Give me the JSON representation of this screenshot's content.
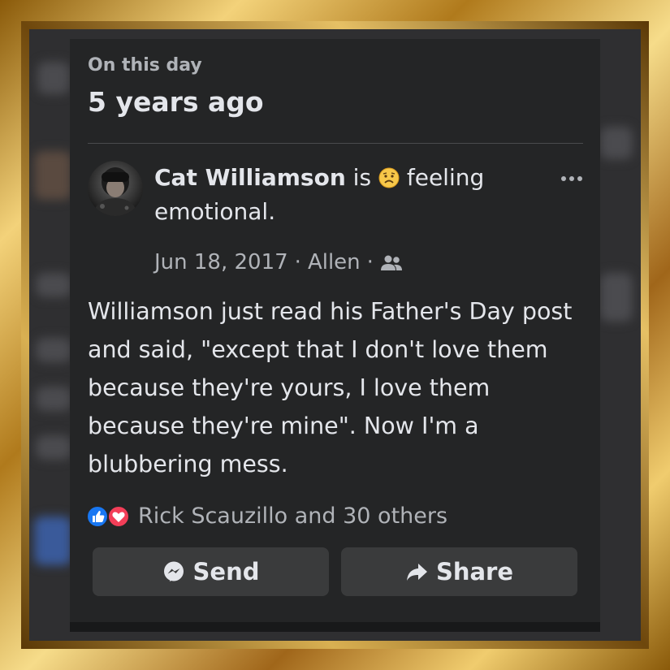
{
  "header": {
    "label": "On this day",
    "title": "5 years ago"
  },
  "post": {
    "author": "Cat Williamson",
    "is_word": "is",
    "feeling_text": "feeling",
    "feeling_value": "emotional.",
    "feeling_icon": "sad-face-icon",
    "date": "Jun 18, 2017",
    "separator": "·",
    "location": "Allen",
    "audience_icon": "friends-icon",
    "body": "Williamson just read his Father's Day post and said, \"except that I don't love them because they're yours, I love them because they're mine\". Now I'm a blubbering mess.",
    "more_icon": "more-options-icon"
  },
  "reactions": {
    "icons": [
      "like-icon",
      "love-icon"
    ],
    "text": "Rick Scauzillo and 30 others"
  },
  "actions": {
    "send_label": "Send",
    "share_label": "Share"
  },
  "colors": {
    "card_bg": "#242526",
    "primary_text": "#e4e6eb",
    "secondary_text": "#b0b3b8",
    "button_bg": "#3a3b3c",
    "like_blue": "#1877f2",
    "love_red": "#f33e58",
    "frame_gold": "#d9b052"
  }
}
